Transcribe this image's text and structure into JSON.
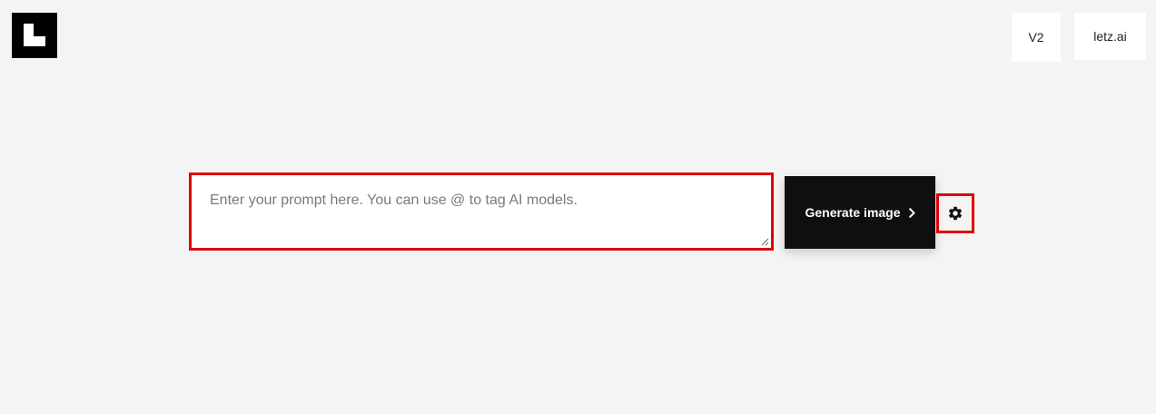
{
  "header": {
    "logo_icon": "letz-logo-icon",
    "version_label": "V2",
    "brand_label": "letz.ai"
  },
  "prompt": {
    "placeholder": "Enter your prompt here. You can use @ to tag AI models.",
    "value": ""
  },
  "actions": {
    "generate_label": "Generate image",
    "generate_icon": "chevron-right-icon",
    "settings_icon": "gear-icon"
  },
  "colors": {
    "background": "#f4f4f4",
    "highlight": "#e00000",
    "button_dark": "#0f0f12",
    "logo": "#000000"
  }
}
